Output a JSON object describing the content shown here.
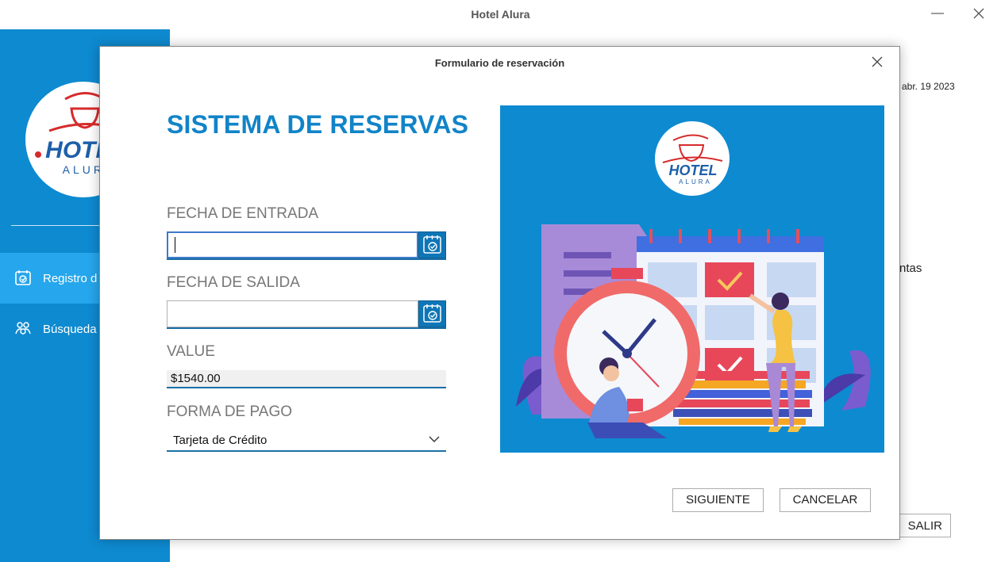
{
  "window": {
    "title": "Hotel Alura",
    "minimize_glyph": "—"
  },
  "sidebar": {
    "logo": {
      "brand_top": "HOTEL",
      "brand_bottom": "ALURA"
    },
    "items": [
      {
        "label": "Registro d",
        "icon": "calendar-check-icon",
        "active": true
      },
      {
        "label": "Búsqueda",
        "icon": "users-search-icon",
        "active": false
      }
    ]
  },
  "background": {
    "date": "abr. 19 2023",
    "partial_text": "ntas",
    "exit_button": "SALIR"
  },
  "dialog": {
    "title": "Formulario de reservación",
    "heading": "SISTEMA DE RESERVAS",
    "checkin": {
      "label": "FECHA DE ENTRADA",
      "value": ""
    },
    "checkout": {
      "label": "FECHA DE SALIDA",
      "value": ""
    },
    "value_field": {
      "label": "VALUE",
      "value": "$1540.00"
    },
    "payment": {
      "label": "FORMA DE PAGO",
      "selected": "Tarjeta de Crédito"
    },
    "illustration_logo": {
      "brand_top": "HOTEL",
      "brand_bottom": "ALURA"
    },
    "buttons": {
      "next": "SIGUIENTE",
      "cancel": "CANCELAR"
    }
  },
  "colors": {
    "brand_blue": "#0e8ad0",
    "accent_blue": "#1184c8",
    "active_item": "#26a6ec",
    "logo_red": "#d62b2b",
    "logo_blue": "#1d5fa8"
  }
}
